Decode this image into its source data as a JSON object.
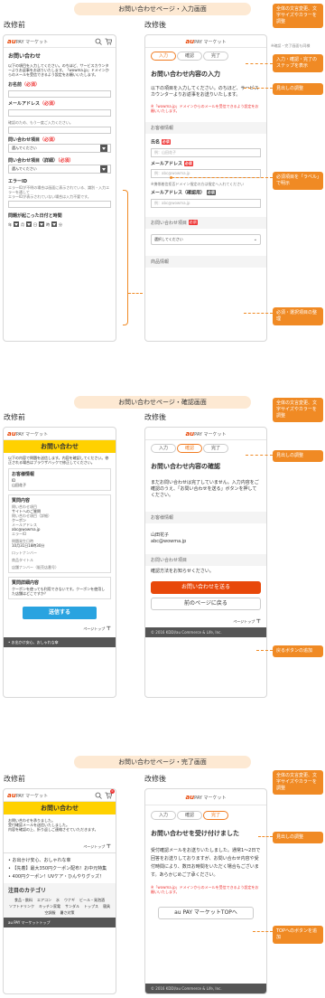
{
  "sections": [
    {
      "title": "お問い合わせページ・入力画面"
    },
    {
      "title": "お問い合わせページ・確認画面"
    },
    {
      "title": "お問い合わせページ・完了画面"
    }
  ],
  "labels": {
    "before": "改修前",
    "after": "改修後"
  },
  "brand": {
    "logo_main": "au",
    "logo_sub": "PAY マーケット",
    "accent": "#e8480a",
    "annotation": "#f08a24",
    "yellow": "#ffd100"
  },
  "note_top": "※確認・完了画面も同様",
  "input_before": {
    "title": "お問い合わせ",
    "intro": "以下の項目を入力してください。のちほど、サービスカウンターよりお返事をお送りいたします。「wowma.jp」ドメインからのメールを受信できるよう設定をお願いいたします。",
    "name_label": "お名前",
    "required": "（必須）",
    "email_label": "メールアドレス",
    "email_confirm_hint": "確認のため、もう一度ご入力ください。",
    "item_label": "問い合わせ項目",
    "item_detail_label": "問い合わせ項目（詳細）",
    "select_placeholder": "選んでください",
    "error_label": "エラーID",
    "error_hint": "エラーIDが不明の場合は画面に表示されている、識別・入力エラーを通して",
    "error_hint2": "エラーIDが表示されていない場合は入力不要です。",
    "date_label": "問題が起こった日付と時間",
    "date_parts": [
      "年",
      "月",
      "日",
      "時",
      "分"
    ]
  },
  "input_after": {
    "steps": [
      "入力",
      "確認",
      "完了"
    ],
    "title": "お問い合わせ内容の入力",
    "intro": "以下の項目を入力してください。のちほど、サービスカウンターよりお返事をお送りいたします。",
    "domain_note": "※「wowma.jp」ドメインからのメールを受信できるよう設定をお願いいたします。",
    "customer_header": "お客様情報",
    "name_label": "氏名",
    "name_placeholder": "例：山田花子",
    "email_label": "メールアドレス",
    "email_placeholder": "例：abc@wowma.jp",
    "email_hint": "※携帯着信拒否ドメイン指定の方は指定へ入れてください",
    "email_confirm_label": "メールアドレス（確認用）",
    "item_header": "お問い合わせ項目",
    "select_placeholder": "選択してください",
    "product_header": "商品情報",
    "required": "必須"
  },
  "ann_input": [
    "全体の文言変更、文字サイズやカラーを調整",
    "入力・確認・完了のステップを表示",
    "見出しの調整",
    "必須項目を「ラベル」で明示",
    "必須・選択項目の整理"
  ],
  "confirm_before": {
    "title": "お問い合わせ",
    "intro": "以下の内容で問題を送信します。内容を確認してください。修正される場合はブラウザバックで修正してください。",
    "customer_header": "お客様情報",
    "id_label": "ID",
    "name_value": "山田花子",
    "q_header": "質問内容",
    "q_item_label": "問い合わせ項目",
    "q_item_value": "サイトへのご質問",
    "q_detail_label": "問い合わせ項目（詳細）",
    "q_detail_value": "クーポン",
    "mail_label": "メールアドレス",
    "mail_value": "abc@wowma.jp",
    "error_label": "エラーID",
    "date_label": "問題発生日時",
    "date_value": "10月31日18時30分",
    "order_label": "ロットナンバー",
    "product_label": "商品タイトル",
    "shop_label": "店舗ナンバー（販売店番号）",
    "detail_header": "質問詳細内容",
    "detail_text": "クーポンを使っても利用できないです。クーポンを使用した店舗はどこですか？",
    "send": "送信する",
    "pagetop": "ページトップ",
    "footer_item": "お出かけ安心、おしゃれな傘"
  },
  "confirm_after": {
    "steps": [
      "入力",
      "確認",
      "完了"
    ],
    "title": "お問い合わせ内容の確認",
    "intro": "まだお問い合わせは完了していません。入力内容をご確認のうえ、「お問い合わせを送る」ボタンを押してください。",
    "customer_header": "お客様情報",
    "name_value": "山田花子",
    "mail_value": "abc@wowma.jp",
    "item_header": "お問い合わせ項目",
    "partial_text": "確認方法をお知らせください。",
    "send": "お問い合わせを送る",
    "back": "前のページに戻る",
    "pagetop": "ページトップ",
    "copyright": "© 2016 KDDI/au Commerce & Life, Inc."
  },
  "ann_confirm": [
    "全体の文言変更、文字サイズやカラーを調整",
    "見出しの調整",
    "戻るボタンの追加"
  ],
  "complete_before": {
    "title": "お問い合わせ",
    "badge": "0",
    "body1": "お問い合わせを承りました。",
    "body2": "受付確認メールを送信いたしました。",
    "body3": "内容を確認の上、折り返しご連絡させていただきます。",
    "pagetop": "ページトップ",
    "list": [
      "お出かけ安心、おしゃれな傘",
      "【先着】最大350円クーポン配布！お中元特集",
      "400円クーポン！UVケア・ひんやりグッズ！"
    ],
    "cat_title": "注目のカテゴリ",
    "cats": [
      "食品・飲料",
      "エアコン",
      "水",
      "ウナギ",
      "ビール・発泡酒",
      "ソフトドリンク",
      "キッチン家電",
      "サンダル",
      "トップス",
      "寝具",
      "空調服",
      "暑さ対策"
    ],
    "footer": "au PAY マーケットトップ"
  },
  "complete_after": {
    "steps": [
      "入力",
      "確認",
      "完了"
    ],
    "title": "お問い合わせを受け付けました",
    "body": "受付確認メールをお送りいたしました。通常1〜2日で回答をお送りしておりますが、お問い合わせ内容や受付時間により、数日お時間をいただく場合もございます。あらかじめご了承ください。",
    "domain_note": "※「wowma.jp」ドメインからのメールを受信できるよう設定をお願いいたします。",
    "top_button": "au PAY マーケットTOPへ",
    "copyright": "© 2016 KDDI/au Commerce & Life, Inc."
  },
  "ann_complete": [
    "全体の文言変更、文字サイズやカラーを調整",
    "見出しの調整",
    "TOPへのボタンを追加"
  ]
}
